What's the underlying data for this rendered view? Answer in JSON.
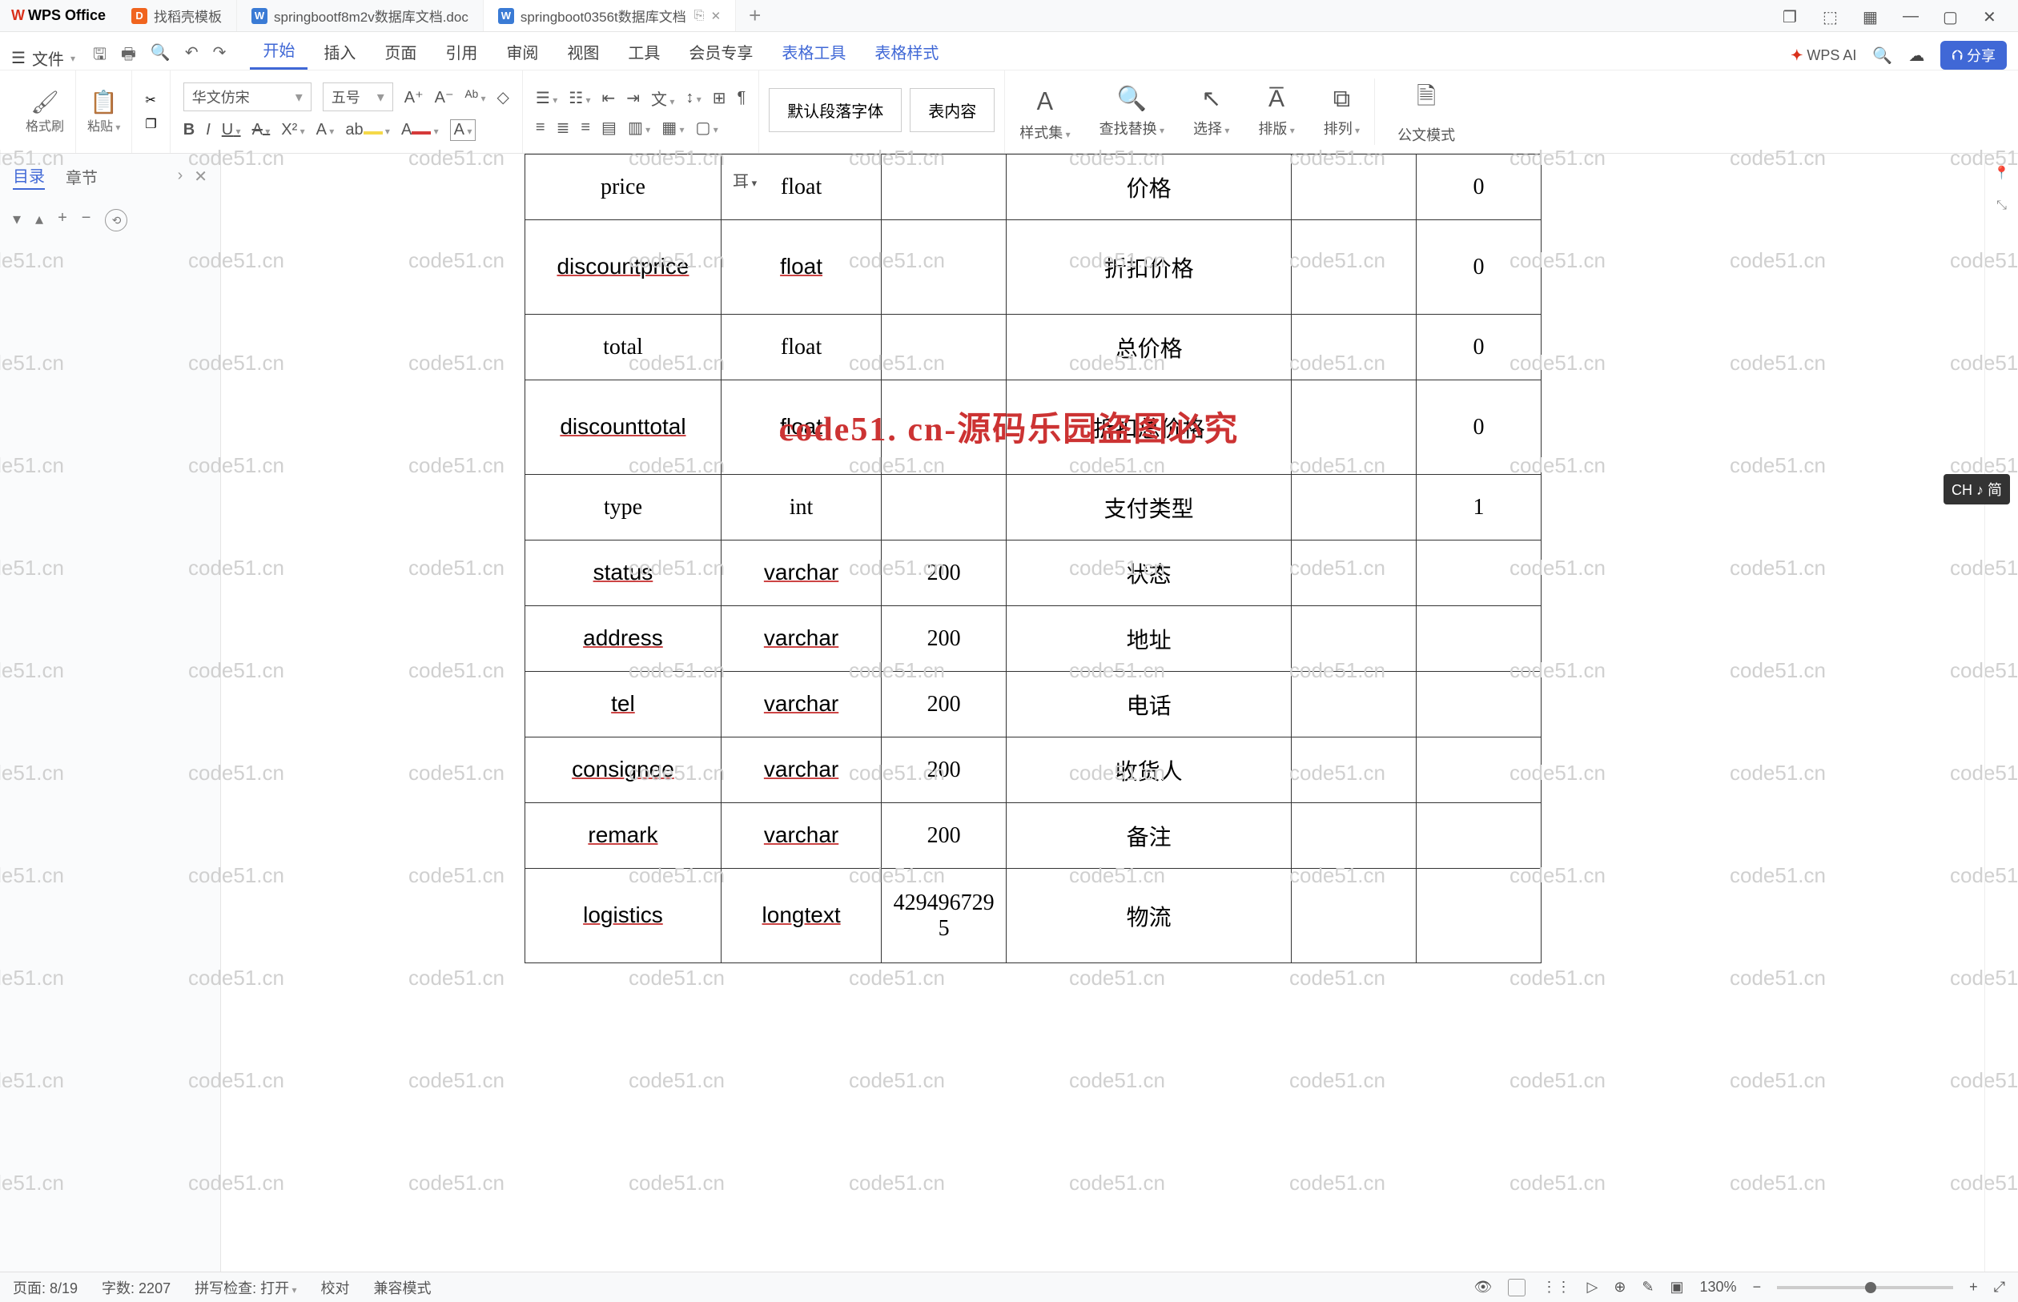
{
  "app": {
    "name": "WPS Office"
  },
  "tabs": [
    {
      "label": "找稻壳模板",
      "icon": "orange"
    },
    {
      "label": "springbootf8m2v数据库文档.doc",
      "icon": "blue"
    },
    {
      "label": "springboot0356t数据库文档",
      "icon": "blue",
      "active": true
    }
  ],
  "menu": {
    "file": "文件",
    "items": [
      "开始",
      "插入",
      "页面",
      "引用",
      "审阅",
      "视图",
      "工具",
      "会员专享",
      "表格工具",
      "表格样式"
    ],
    "active": "开始",
    "wpsai": "WPS AI",
    "share": "分享"
  },
  "ribbon": {
    "format_painter": "格式刷",
    "paste": "粘贴",
    "font_family": "华文仿宋",
    "font_size": "五号",
    "para_default": "默认段落字体",
    "para_content": "表内容",
    "style_set": "样式集",
    "find_replace": "查找替换",
    "select": "选择",
    "layout": "排版",
    "arrange": "排列",
    "gov_mode": "公文模式"
  },
  "leftpanel": {
    "tab1": "目录",
    "tab2": "章节"
  },
  "ruler": "耳",
  "watermark": "code51.cn",
  "big_watermark": "code51. cn-源码乐园盗图必究",
  "ime": "CH ♪ 简",
  "table_rows": [
    {
      "c1": "price",
      "c2": "float",
      "c3": "",
      "c4": "价格",
      "c5": "",
      "c6": "0",
      "u": false,
      "tall": false
    },
    {
      "c1": "discountprice",
      "c2": "float",
      "c3": "",
      "c4": "折扣价格",
      "c5": "",
      "c6": "0",
      "u": true,
      "tall": true
    },
    {
      "c1": "total",
      "c2": "float",
      "c3": "",
      "c4": "总价格",
      "c5": "",
      "c6": "0",
      "u": false,
      "tall": false
    },
    {
      "c1": "discounttotal",
      "c2": "float",
      "c3": "",
      "c4": "折扣总价格",
      "c5": "",
      "c6": "0",
      "u": true,
      "tall": true
    },
    {
      "c1": "type",
      "c2": "int",
      "c3": "",
      "c4": "支付类型",
      "c5": "",
      "c6": "1",
      "u": false,
      "tall": false
    },
    {
      "c1": "status",
      "c2": "varchar",
      "c3": "200",
      "c4": "状态",
      "c5": "",
      "c6": "",
      "u": true,
      "tall": false
    },
    {
      "c1": "address",
      "c2": "varchar",
      "c3": "200",
      "c4": "地址",
      "c5": "",
      "c6": "",
      "u": true,
      "tall": false
    },
    {
      "c1": "tel",
      "c2": "varchar",
      "c3": "200",
      "c4": "电话",
      "c5": "",
      "c6": "",
      "u": true,
      "tall": false
    },
    {
      "c1": "consignee",
      "c2": "varchar",
      "c3": "200",
      "c4": "收货人",
      "c5": "",
      "c6": "",
      "u": true,
      "tall": false
    },
    {
      "c1": "remark",
      "c2": "varchar",
      "c3": "200",
      "c4": "备注",
      "c5": "",
      "c6": "",
      "u": true,
      "tall": false
    },
    {
      "c1": "logistics",
      "c2": "longtext",
      "c3": "4294967295",
      "c4": "物流",
      "c5": "",
      "c6": "",
      "u": true,
      "tall": true
    }
  ],
  "status": {
    "page": "页面: 8/19",
    "words": "字数: 2207",
    "spell": "拼写检查: 打开",
    "proof": "校对",
    "compat": "兼容模式",
    "zoom": "130%"
  }
}
